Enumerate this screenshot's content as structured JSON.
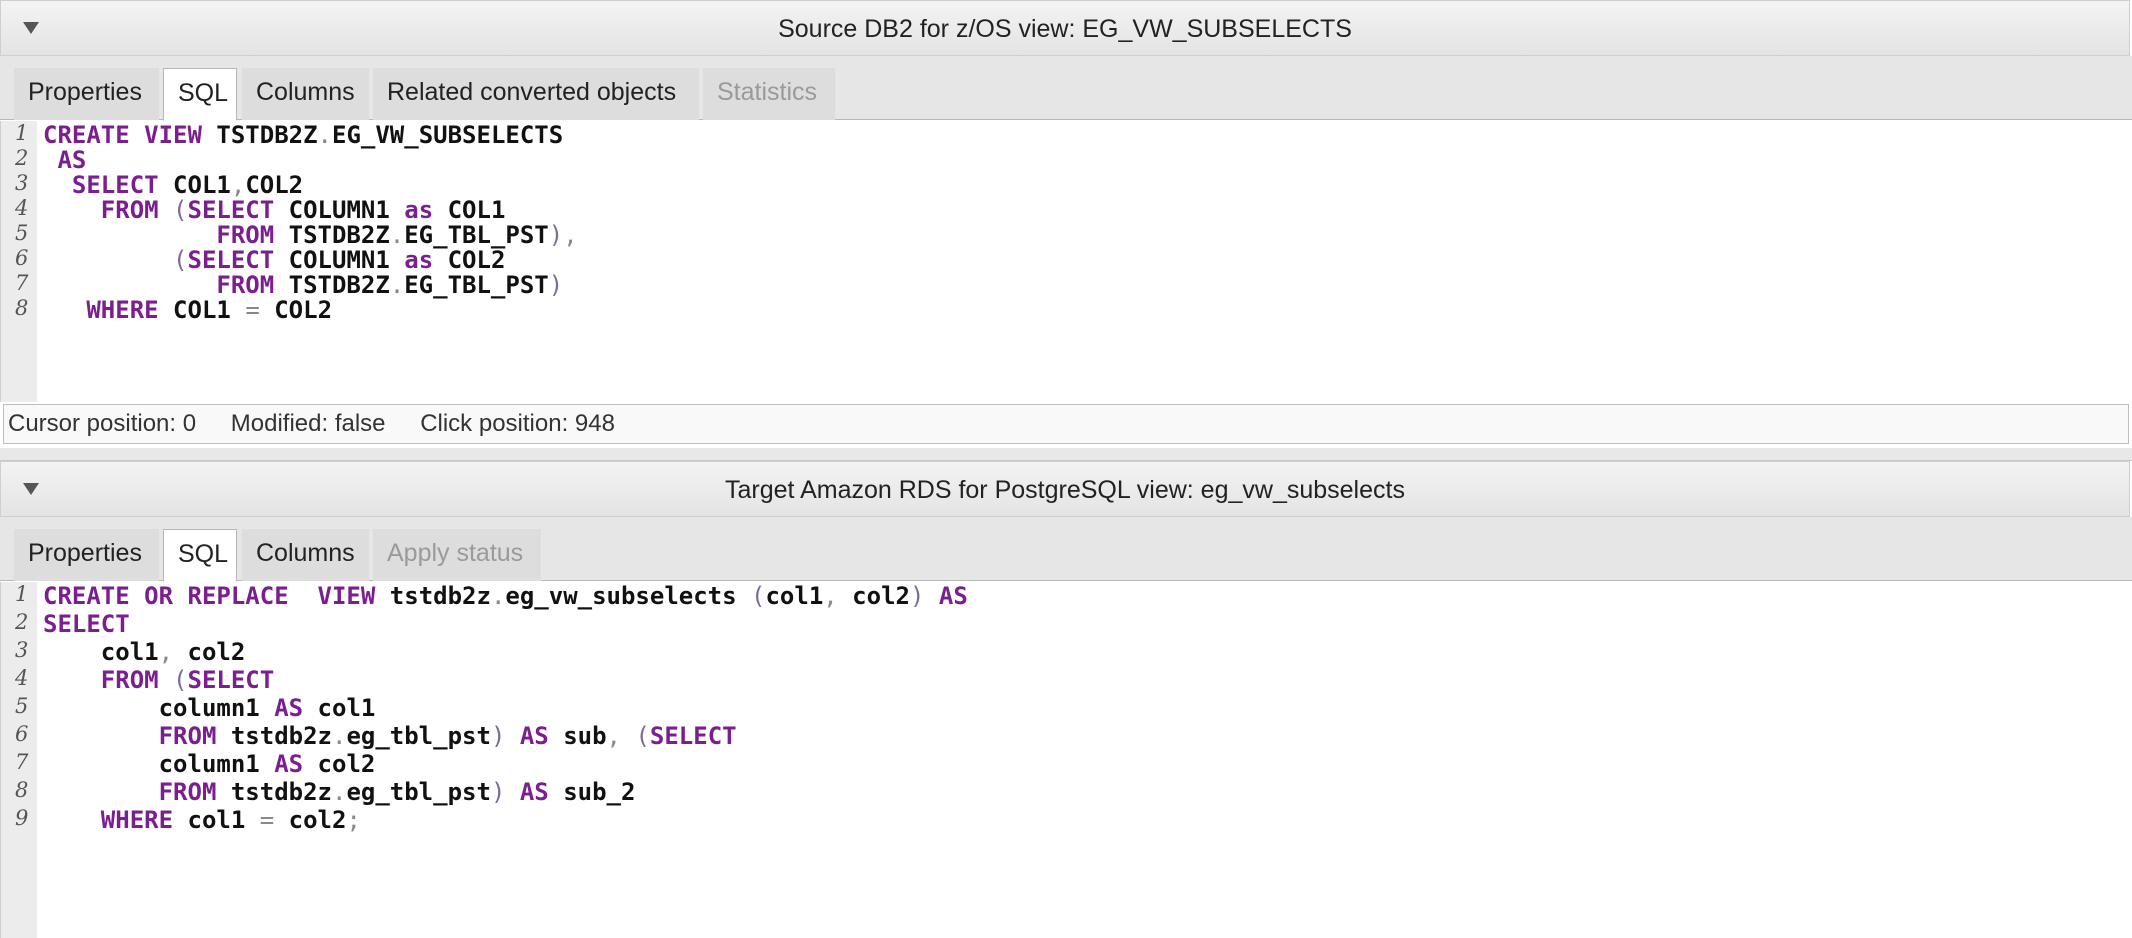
{
  "source": {
    "title": "Source DB2 for z/OS view: EG_VW_SUBSELECTS",
    "tabs": [
      "Properties",
      "SQL",
      "Columns",
      "Related converted objects",
      "Statistics"
    ],
    "status": {
      "cursor": "Cursor position: 0",
      "modified": "Modified: false",
      "click": "Click position: 948"
    },
    "lines": [
      {
        "n": "1",
        "tokens": [
          [
            "kw",
            "CREATE VIEW"
          ],
          [
            "t",
            " TSTDB2Z"
          ],
          [
            "pn",
            "."
          ],
          [
            "t",
            "EG_VW_SUBSELECTS"
          ]
        ]
      },
      {
        "n": "2",
        "tokens": [
          [
            "t",
            " "
          ],
          [
            "kw",
            "AS"
          ]
        ]
      },
      {
        "n": "3",
        "tokens": [
          [
            "t",
            "  "
          ],
          [
            "kw",
            "SELECT"
          ],
          [
            "t",
            " COL1"
          ],
          [
            "pn",
            ","
          ],
          [
            "t",
            "COL2"
          ]
        ]
      },
      {
        "n": "4",
        "tokens": [
          [
            "t",
            "    "
          ],
          [
            "kw",
            "FROM"
          ],
          [
            "t",
            " "
          ],
          [
            "pv",
            "("
          ],
          [
            "kw",
            "SELECT"
          ],
          [
            "t",
            " COLUMN1 "
          ],
          [
            "kw",
            "as"
          ],
          [
            "t",
            " COL1"
          ]
        ]
      },
      {
        "n": "5",
        "tokens": [
          [
            "t",
            "            "
          ],
          [
            "kw",
            "FROM"
          ],
          [
            "t",
            " TSTDB2Z"
          ],
          [
            "pn",
            "."
          ],
          [
            "t",
            "EG_TBL_PST"
          ],
          [
            "pv",
            ")"
          ],
          [
            "pn",
            ","
          ]
        ]
      },
      {
        "n": "6",
        "tokens": [
          [
            "t",
            "         "
          ],
          [
            "pv",
            "("
          ],
          [
            "kw",
            "SELECT"
          ],
          [
            "t",
            " COLUMN1 "
          ],
          [
            "kw",
            "as"
          ],
          [
            "t",
            " COL2"
          ]
        ]
      },
      {
        "n": "7",
        "tokens": [
          [
            "t",
            "            "
          ],
          [
            "kw",
            "FROM"
          ],
          [
            "t",
            " TSTDB2Z"
          ],
          [
            "pn",
            "."
          ],
          [
            "t",
            "EG_TBL_PST"
          ],
          [
            "pv",
            ")"
          ]
        ]
      },
      {
        "n": "8",
        "tokens": [
          [
            "t",
            "   "
          ],
          [
            "kw",
            "WHERE"
          ],
          [
            "t",
            " COL1 "
          ],
          [
            "pn",
            "="
          ],
          [
            "t",
            " COL2"
          ]
        ]
      }
    ]
  },
  "target": {
    "title": "Target Amazon RDS for PostgreSQL view: eg_vw_subselects",
    "tabs": [
      "Properties",
      "SQL",
      "Columns",
      "Apply status"
    ],
    "lines": [
      {
        "n": "1",
        "tokens": [
          [
            "kw",
            "CREATE OR REPLACE  VIEW"
          ],
          [
            "t",
            " tstdb2z"
          ],
          [
            "pn",
            "."
          ],
          [
            "t",
            "eg_vw_subselects "
          ],
          [
            "pv",
            "("
          ],
          [
            "t",
            "col1"
          ],
          [
            "pn",
            ","
          ],
          [
            "t",
            " col2"
          ],
          [
            "pv",
            ")"
          ],
          [
            "t",
            " "
          ],
          [
            "kw",
            "AS"
          ]
        ]
      },
      {
        "n": "2",
        "tokens": [
          [
            "kw",
            "SELECT"
          ]
        ]
      },
      {
        "n": "3",
        "tokens": [
          [
            "t",
            "    col1"
          ],
          [
            "pn",
            ","
          ],
          [
            "t",
            " col2"
          ]
        ]
      },
      {
        "n": "4",
        "tokens": [
          [
            "t",
            "    "
          ],
          [
            "kw",
            "FROM"
          ],
          [
            "t",
            " "
          ],
          [
            "pv",
            "("
          ],
          [
            "kw",
            "SELECT"
          ]
        ]
      },
      {
        "n": "5",
        "tokens": [
          [
            "t",
            "        column1 "
          ],
          [
            "kw",
            "AS"
          ],
          [
            "t",
            " col1"
          ]
        ]
      },
      {
        "n": "6",
        "tokens": [
          [
            "t",
            "        "
          ],
          [
            "kw",
            "FROM"
          ],
          [
            "t",
            " tstdb2z"
          ],
          [
            "pn",
            "."
          ],
          [
            "t",
            "eg_tbl_pst"
          ],
          [
            "pv",
            ")"
          ],
          [
            "t",
            " "
          ],
          [
            "kw",
            "AS"
          ],
          [
            "t",
            " sub"
          ],
          [
            "pn",
            ","
          ],
          [
            "t",
            " "
          ],
          [
            "pv",
            "("
          ],
          [
            "kw",
            "SELECT"
          ]
        ]
      },
      {
        "n": "7",
        "tokens": [
          [
            "t",
            "        column1 "
          ],
          [
            "kw",
            "AS"
          ],
          [
            "t",
            " col2"
          ]
        ]
      },
      {
        "n": "8",
        "tokens": [
          [
            "t",
            "        "
          ],
          [
            "kw",
            "FROM"
          ],
          [
            "t",
            " tstdb2z"
          ],
          [
            "pn",
            "."
          ],
          [
            "t",
            "eg_tbl_pst"
          ],
          [
            "pv",
            ")"
          ],
          [
            "t",
            " "
          ],
          [
            "kw",
            "AS"
          ],
          [
            "t",
            " sub_2"
          ]
        ]
      },
      {
        "n": "9",
        "tokens": [
          [
            "t",
            "    "
          ],
          [
            "kw",
            "WHERE"
          ],
          [
            "t",
            " col1 "
          ],
          [
            "pn",
            "="
          ],
          [
            "t",
            " col2"
          ],
          [
            "pn",
            ";"
          ]
        ]
      }
    ]
  }
}
